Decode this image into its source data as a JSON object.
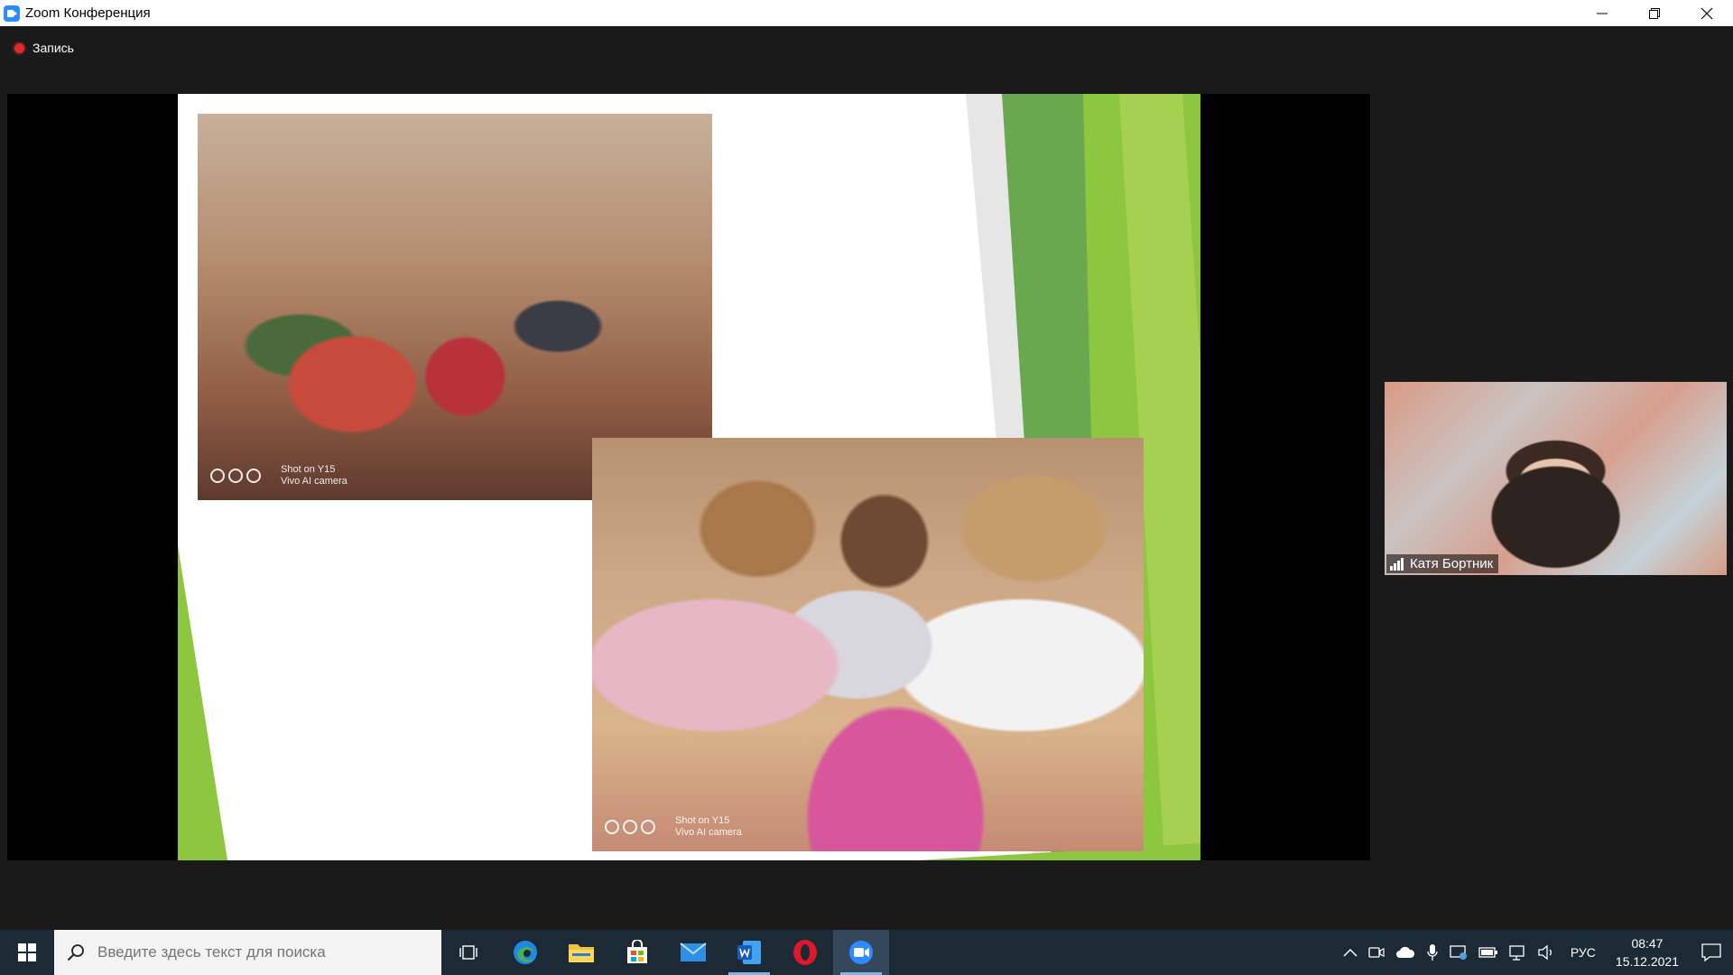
{
  "window": {
    "title": "Zoom Конференция",
    "controls": [
      "minimize",
      "restore",
      "close"
    ]
  },
  "recording": {
    "label": "Запись",
    "color": "#e02b2b"
  },
  "shared_slide": {
    "accent_colors": [
      "#8dc63f",
      "#6aa84f",
      "#b5d96b"
    ],
    "photo1_watermark": {
      "line1": "Shot on Y15",
      "line2": "Vivo AI camera"
    },
    "photo2_watermark": {
      "line1": "Shot on Y15",
      "line2": "Vivo AI camera"
    }
  },
  "participant": {
    "name": "Катя Бортник"
  },
  "taskbar": {
    "search_placeholder": "Введите здесь текст для поиска",
    "apps": [
      "task-view",
      "edge",
      "file-explorer",
      "microsoft-store",
      "mail",
      "word",
      "opera",
      "zoom"
    ],
    "language": "РУС",
    "time": "08:47",
    "date": "15.12.2021"
  }
}
